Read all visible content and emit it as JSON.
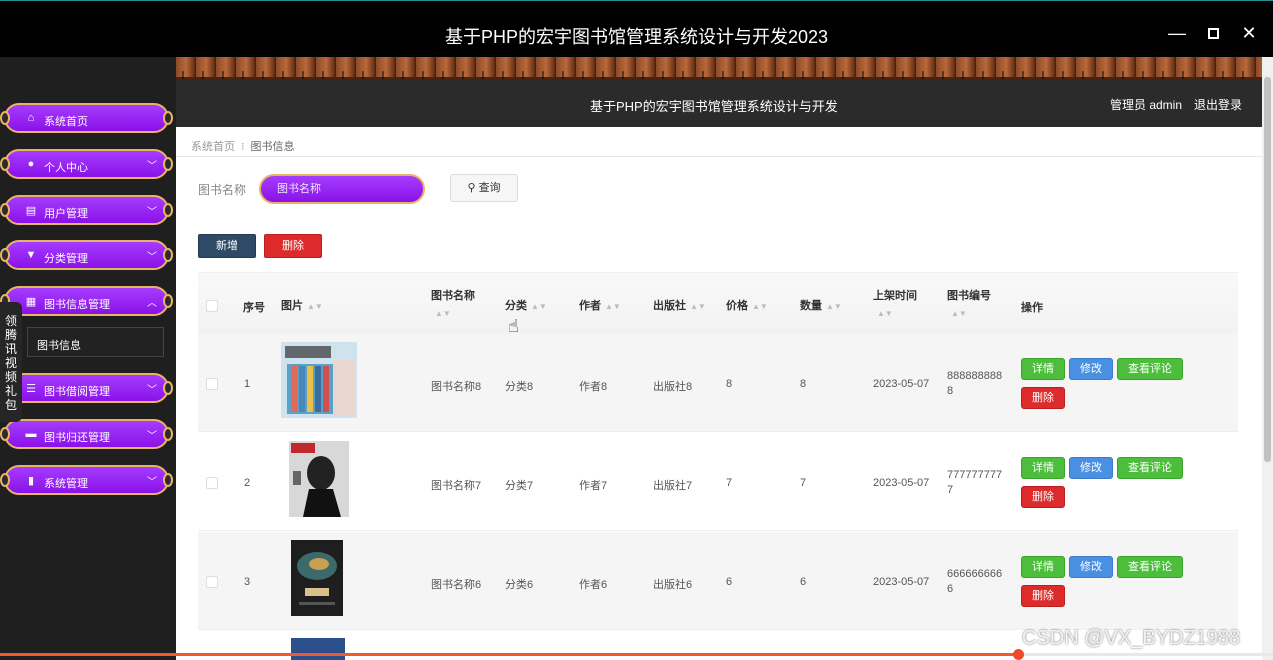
{
  "window": {
    "title": "基于PHP的宏宇图书馆管理系统设计与开发2023",
    "minimize": "—",
    "close": "✕"
  },
  "header": {
    "title": "基于PHP的宏宇图书馆管理系统设计与开发",
    "admin_text": "管理员 admin",
    "logout": "退出登录"
  },
  "sidebar": {
    "items": [
      {
        "label": "系统首页",
        "icon": "home-icon"
      },
      {
        "label": "个人中心",
        "icon": "user-icon"
      },
      {
        "label": "用户管理",
        "icon": "clipboard-icon"
      },
      {
        "label": "分类管理",
        "icon": "filter-icon"
      },
      {
        "label": "图书信息管理",
        "icon": "grid-icon"
      },
      {
        "label": "图书借阅管理",
        "icon": "list-icon"
      },
      {
        "label": "图书归还管理",
        "icon": "ticket-icon"
      },
      {
        "label": "系统管理",
        "icon": "book-icon"
      }
    ],
    "submenu_item": "图书信息",
    "vertical_tab": "领腾讯视频礼包"
  },
  "breadcrumb": {
    "home": "系统首页",
    "separator": "⁝",
    "current": "图书信息"
  },
  "search": {
    "label": "图书名称",
    "placeholder": "图书名称",
    "button": "查询"
  },
  "toolbar": {
    "add": "新增",
    "delete": "删除"
  },
  "table": {
    "headers": {
      "index": "序号",
      "image": "图片",
      "name": "图书名称",
      "category": "分类",
      "author": "作者",
      "publisher": "出版社",
      "price": "价格",
      "quantity": "数量",
      "date": "上架时间",
      "code": "图书编号",
      "actions": "操作"
    },
    "rows": [
      {
        "index": "1",
        "name": "图书名称8",
        "category": "分类8",
        "author": "作者8",
        "publisher": "出版社8",
        "price": "8",
        "quantity": "8",
        "date": "2023-05-07",
        "code_line1": "888888888",
        "code_line2": "8"
      },
      {
        "index": "2",
        "name": "图书名称7",
        "category": "分类7",
        "author": "作者7",
        "publisher": "出版社7",
        "price": "7",
        "quantity": "7",
        "date": "2023-05-07",
        "code_line1": "777777777",
        "code_line2": "7"
      },
      {
        "index": "3",
        "name": "图书名称6",
        "category": "分类6",
        "author": "作者6",
        "publisher": "出版社6",
        "price": "6",
        "quantity": "6",
        "date": "2023-05-07",
        "code_line1": "666666666",
        "code_line2": "6"
      }
    ],
    "action_labels": {
      "detail": "详情",
      "edit": "修改",
      "comment": "查看评论",
      "delete": "删除"
    }
  },
  "player": {
    "progress_fraction": 0.8
  },
  "watermark": "CSDN @VX_BYDZ1988"
}
